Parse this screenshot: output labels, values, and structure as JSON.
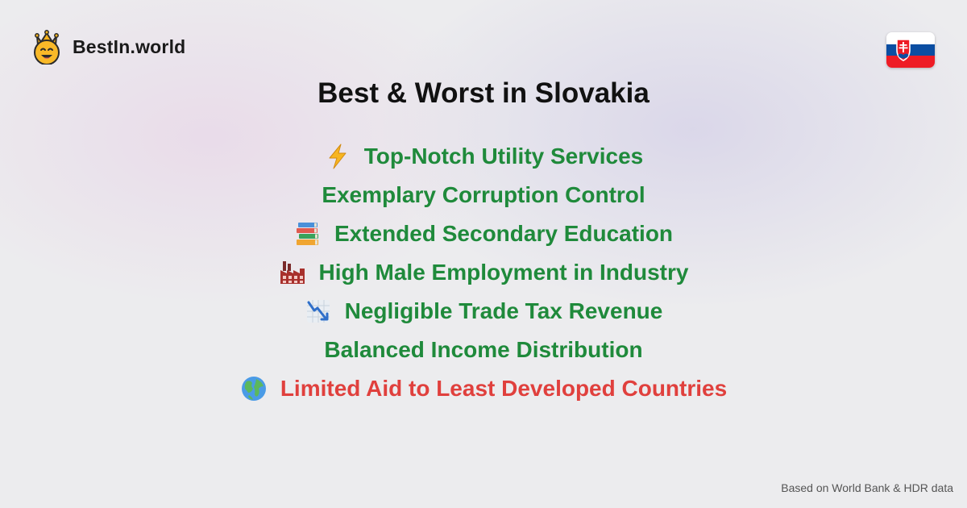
{
  "brand": {
    "name": "BestIn.world",
    "logo_icon": "crowned-smiley-icon"
  },
  "flag": {
    "country": "Slovakia",
    "icon": "slovakia-flag-icon",
    "colors": [
      "#ffffff",
      "#0b4ea2",
      "#ee1c25"
    ]
  },
  "title": "Best & Worst in Slovakia",
  "colors": {
    "best": "#1f8a3b",
    "worst": "#e0403d",
    "title": "#111111"
  },
  "items": [
    {
      "label": "Top-Notch Utility Services",
      "icon": "lightning-icon",
      "type": "best"
    },
    {
      "label": "Exemplary Corruption Control",
      "icon": "",
      "type": "best"
    },
    {
      "label": "Extended Secondary Education",
      "icon": "books-icon",
      "type": "best"
    },
    {
      "label": "High Male Employment in Industry",
      "icon": "factory-icon",
      "type": "best"
    },
    {
      "label": "Negligible Trade Tax Revenue",
      "icon": "chart-decreasing-icon",
      "type": "best"
    },
    {
      "label": "Balanced Income Distribution",
      "icon": "",
      "type": "best"
    },
    {
      "label": "Limited Aid to Least Developed Countries",
      "icon": "globe-icon",
      "type": "worst"
    }
  ],
  "footer": "Based on World Bank & HDR data"
}
